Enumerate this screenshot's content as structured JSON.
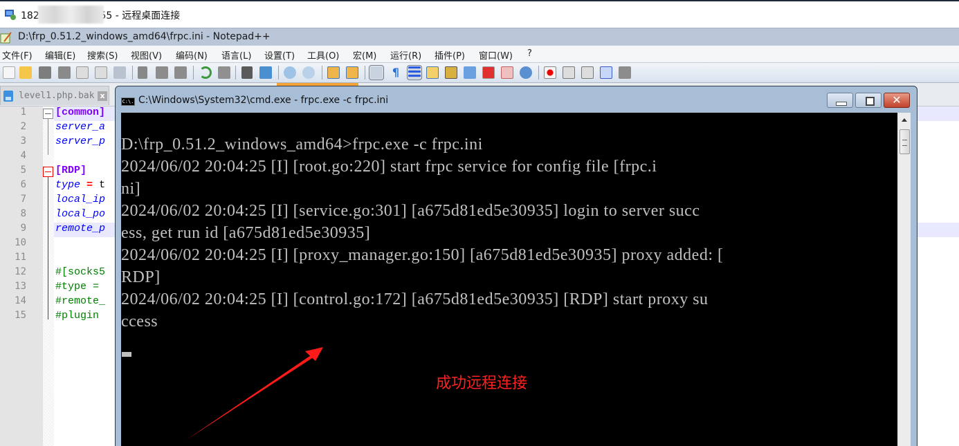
{
  "rdp_window": {
    "title": "182.      555 - 远程桌面连接"
  },
  "npp_window": {
    "title": "D:\\frp_0.51.2_windows_amd64\\frpc.ini - Notepad++",
    "menu": [
      "文件(F)",
      "编辑(E)",
      "搜索(S)",
      "视图(V)",
      "编码(N)",
      "语言(L)",
      "设置(T)",
      "工具(O)",
      "宏(M)",
      "运行(R)",
      "插件(P)",
      "窗口(W)",
      "?"
    ],
    "toolbar": [
      "new-file",
      "open-file",
      "save",
      "save-all",
      "close",
      "close-all",
      "print",
      "cut",
      "copy",
      "paste",
      "undo",
      "redo",
      "find",
      "replace",
      "zoom-in",
      "zoom-out",
      "sync-vertical",
      "sync-horizontal",
      "word-wrap",
      "show-all-chars",
      "indent-guide",
      "udl",
      "doc-map",
      "doc-list",
      "function-list",
      "folder-workspace",
      "monitor",
      "record-macro",
      "stop-recording",
      "playback-macro",
      "run-macro-multiple",
      "save-macro"
    ],
    "tabs": [
      {
        "label": "level1.php.bak",
        "close": "x"
      }
    ],
    "lines": [
      {
        "n": "1",
        "text": "[common]",
        "type": "sect"
      },
      {
        "n": "2",
        "text": "server_a",
        "type": "key"
      },
      {
        "n": "3",
        "text": "server_p",
        "type": "key"
      },
      {
        "n": "4",
        "text": "",
        "type": "plain"
      },
      {
        "n": "5",
        "text": "[RDP]",
        "type": "sect"
      },
      {
        "n": "6",
        "key": "type",
        "op": "=",
        "rest": "t",
        "type": "assign"
      },
      {
        "n": "7",
        "text": "local_ip",
        "type": "key"
      },
      {
        "n": "8",
        "text": "local_po",
        "type": "key"
      },
      {
        "n": "9",
        "text": "remote_p",
        "type": "key"
      },
      {
        "n": "10",
        "text": "",
        "type": "plain"
      },
      {
        "n": "11",
        "text": "",
        "type": "plain"
      },
      {
        "n": "12",
        "text": "#[socks5",
        "type": "cmt"
      },
      {
        "n": "13",
        "text": "#type =",
        "type": "cmt"
      },
      {
        "n": "14",
        "text": "#remote_",
        "type": "cmt"
      },
      {
        "n": "15",
        "text": "#plugin",
        "type": "cmt"
      }
    ]
  },
  "cmd_window": {
    "title": "C:\\Windows\\System32\\cmd.exe - frpc.exe  -c frpc.ini",
    "icon_label": "C:\\.",
    "close_glyph": "✕",
    "console_lines": [
      "D:\\frp_0.51.2_windows_amd64>frpc.exe -c frpc.ini",
      "2024/06/02 20:04:25 [I] [root.go:220] start frpc service for config file [frpc.i",
      "ni]",
      "2024/06/02 20:04:25 [I] [service.go:301] [a675d81ed5e30935] login to server succ",
      "ess, get run id [a675d81ed5e30935]",
      "2024/06/02 20:04:25 [I] [proxy_manager.go:150] [a675d81ed5e30935] proxy added: [",
      "RDP]",
      "2024/06/02 20:04:25 [I] [control.go:172] [a675d81ed5e30935] [RDP] start proxy su",
      "ccess"
    ]
  },
  "annotation": {
    "text": "成功远程连接",
    "color": "#ff2020"
  }
}
